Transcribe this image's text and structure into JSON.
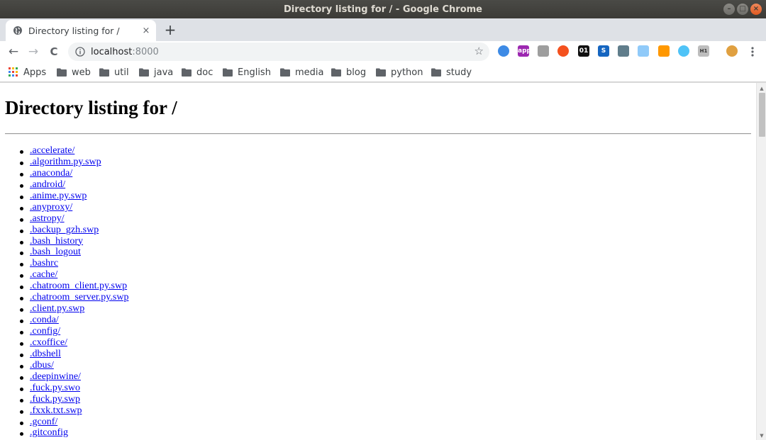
{
  "window": {
    "title": "Directory listing for / - Google Chrome",
    "controls": [
      "–",
      "□",
      "×"
    ]
  },
  "tab": {
    "title": "Directory listing for /",
    "close": "×",
    "new_tab": "+"
  },
  "toolbar": {
    "back": "←",
    "forward": "→",
    "reload": "C",
    "url_host": "localhost",
    "url_port": ":8000",
    "star": "☆",
    "extensions": [
      {
        "name": "ext-blue-circle",
        "label": "",
        "color": "#3d8ae5"
      },
      {
        "name": "ext-purple-app",
        "label": "app",
        "color": "#9c27b0"
      },
      {
        "name": "ext-gray-shield",
        "label": "",
        "color": "#9e9e9e"
      },
      {
        "name": "ext-orange-circle",
        "label": "",
        "color": "#f4511e"
      },
      {
        "name": "ext-01",
        "label": "01",
        "color": "#111111"
      },
      {
        "name": "ext-blue-s",
        "label": "S",
        "color": "#1565c0"
      },
      {
        "name": "ext-satellite",
        "label": "",
        "color": "#607d8b"
      },
      {
        "name": "ext-doc",
        "label": "",
        "color": "#90caf9"
      },
      {
        "name": "ext-speedometer",
        "label": "",
        "color": "#ff9800"
      },
      {
        "name": "ext-ring",
        "label": "",
        "color": "#4fc3f7"
      },
      {
        "name": "ext-h1",
        "label": "H1",
        "color": "#bdbdbd"
      },
      {
        "name": "ext-avatar",
        "label": "",
        "color": "#e0a040"
      }
    ],
    "menu": "⋮"
  },
  "bookmarks": [
    {
      "label": "Apps",
      "type": "apps"
    },
    {
      "label": "web",
      "type": "folder"
    },
    {
      "label": "util",
      "type": "folder"
    },
    {
      "label": "java",
      "type": "folder"
    },
    {
      "label": "doc",
      "type": "folder"
    },
    {
      "label": "English",
      "type": "folder"
    },
    {
      "label": "media",
      "type": "folder"
    },
    {
      "label": "blog",
      "type": "folder"
    },
    {
      "label": "python",
      "type": "folder"
    },
    {
      "label": "study",
      "type": "folder"
    }
  ],
  "page": {
    "heading": "Directory listing for /",
    "entries": [
      ".accelerate/",
      ".algorithm.py.swp",
      ".anaconda/",
      ".android/",
      ".anime.py.swp",
      ".anyproxy/",
      ".astropy/",
      ".backup_gzh.swp",
      ".bash_history",
      ".bash_logout",
      ".bashrc",
      ".cache/",
      ".chatroom_client.py.swp",
      ".chatroom_server.py.swp",
      ".client.py.swp",
      ".conda/",
      ".config/",
      ".cxoffice/",
      ".dbshell",
      ".dbus/",
      ".deepinwine/",
      ".fuck.py.swo",
      ".fuck.py.swp",
      ".fxxk.txt.swp",
      ".gconf/",
      ".gitconfig"
    ]
  },
  "scrollbar": {
    "up": "▲",
    "down": "▼"
  }
}
